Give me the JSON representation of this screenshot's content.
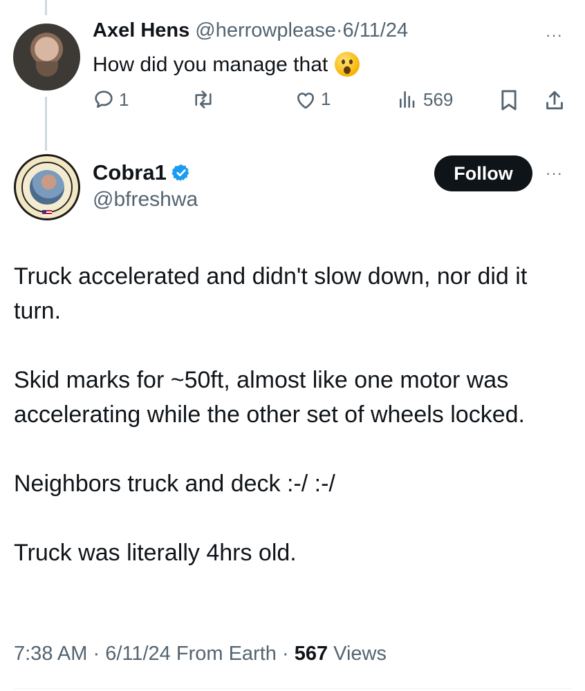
{
  "reply": {
    "display_name": "Axel Hens",
    "handle": "@herrowplease",
    "separator": "·",
    "date": "6/11/24",
    "text": "How did you manage that",
    "emoji_icon": "face-with-open-mouth-icon",
    "actions": {
      "replies": "1",
      "reposts": "",
      "likes": "1",
      "views": "569"
    },
    "more_label": "···"
  },
  "tweet": {
    "display_name": "Cobra1",
    "handle": "@bfreshwa",
    "verified": true,
    "follow_label": "Follow",
    "more_label": "···",
    "paragraphs": [
      "Truck accelerated and didn't slow down, nor did it turn.",
      "Skid marks for ~50ft, almost like one motor was accelerating while the other set of wheels locked.",
      "Neighbors truck and deck :-/ :-/",
      "Truck was literally 4hrs old."
    ],
    "time": "7:38 AM",
    "date": "6/11/24",
    "source": "From Earth",
    "views_count": "567",
    "views_label": "Views",
    "separator": "·"
  },
  "colors": {
    "text": "#0f1419",
    "muted": "#536471",
    "verified_blue": "#1d9bf0",
    "follow_bg": "#0f1419",
    "thread_line": "#cfd9de"
  }
}
